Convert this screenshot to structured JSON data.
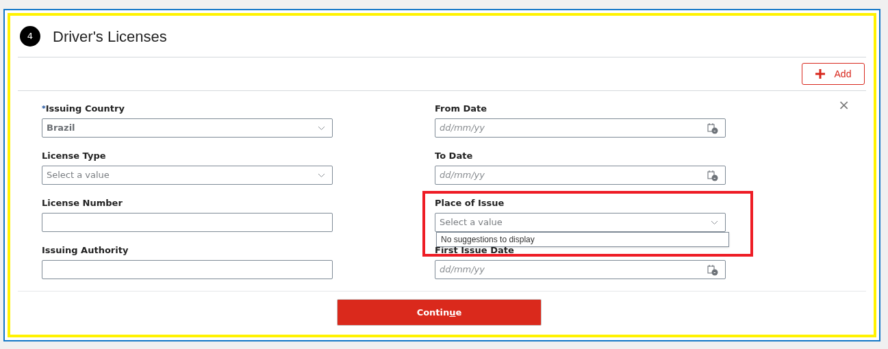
{
  "section": {
    "step": "4",
    "title": "Driver's Licenses"
  },
  "add_button": {
    "label": "Add"
  },
  "fields": [
    {
      "kind": "select",
      "label": "Issuing Country",
      "required_mark": "*",
      "value": "Brazil"
    },
    {
      "kind": "date",
      "label": "From Date",
      "placeholder": "dd/mm/yy"
    },
    {
      "kind": "select",
      "label": "License Type",
      "placeholder": "Select a value"
    },
    {
      "kind": "date",
      "label": "To Date",
      "placeholder": "dd/mm/yy"
    },
    {
      "kind": "text",
      "label": "License Number"
    },
    {
      "kind": "select",
      "label": "Place of Issue",
      "placeholder": "Select a value",
      "suggestions_message": "No suggestions to display",
      "highlighted": true
    },
    {
      "kind": "text",
      "label": "Issuing Authority"
    },
    {
      "kind": "date",
      "label": "First Issue Date",
      "placeholder": "dd/mm/yy"
    }
  ],
  "close_button": {
    "label": "×"
  },
  "continue_button": {
    "label_before": "Contin",
    "access_key": "u",
    "label_after": "e"
  }
}
